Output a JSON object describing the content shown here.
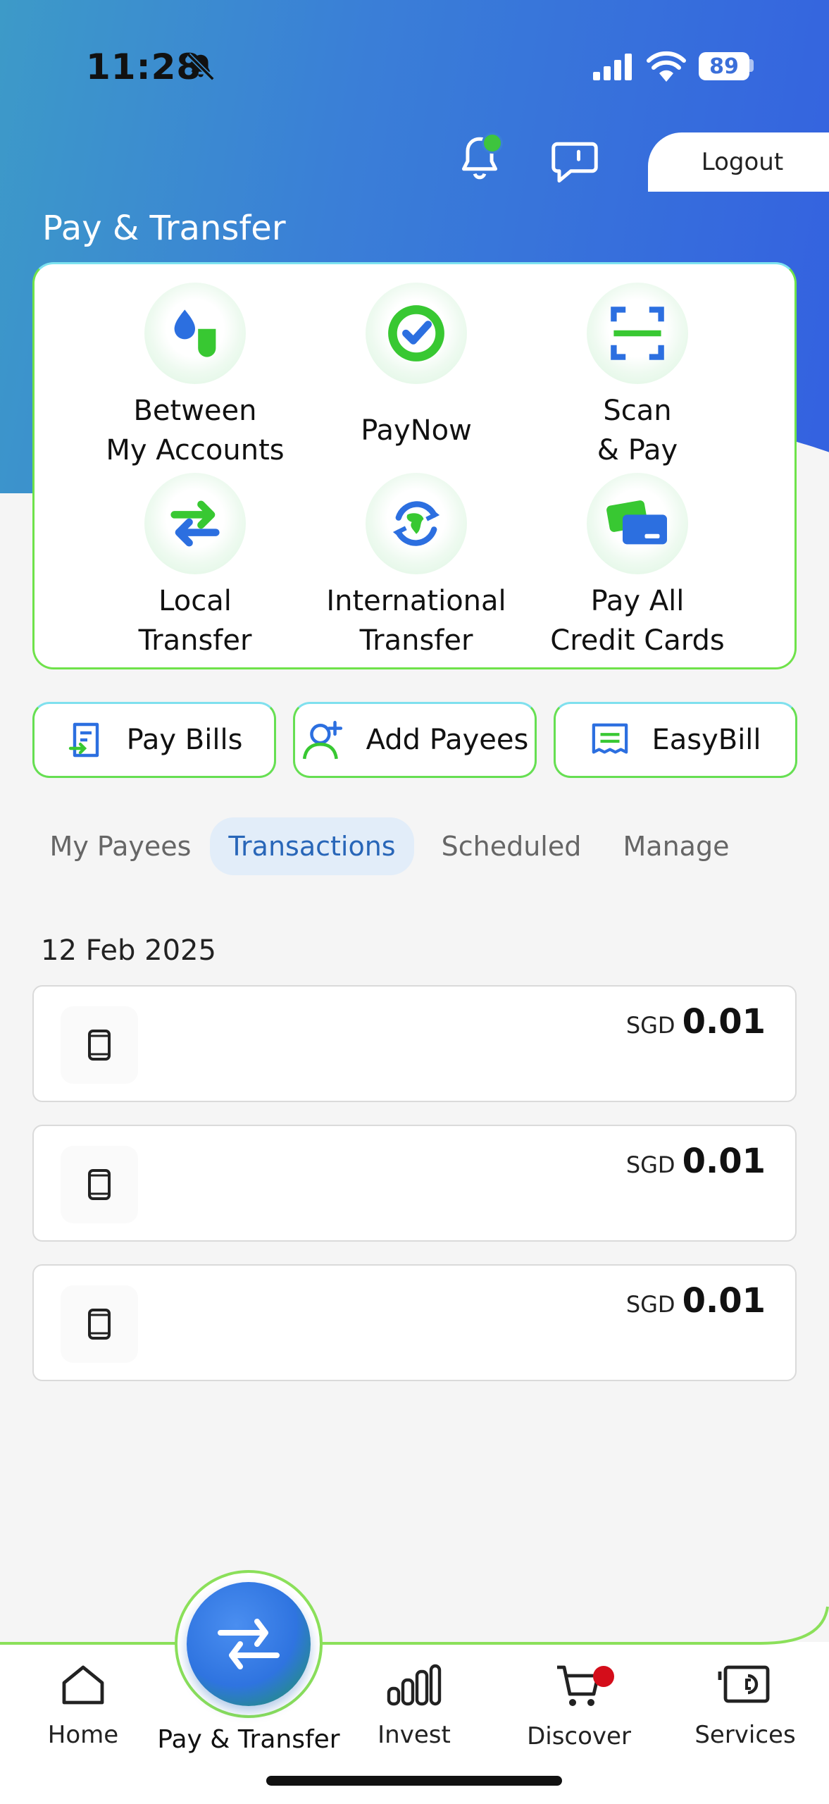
{
  "status_bar": {
    "time": "11:28",
    "battery": "89"
  },
  "header": {
    "logout_label": "Logout",
    "title": "Pay & Transfer"
  },
  "quick_actions": [
    {
      "label": "Between\nMy Accounts",
      "icon": "between-accounts-icon"
    },
    {
      "label": "PayNow",
      "icon": "paynow-icon"
    },
    {
      "label": "Scan\n& Pay",
      "icon": "scan-icon"
    },
    {
      "label": "Local\nTransfer",
      "icon": "local-transfer-icon"
    },
    {
      "label": "International\nTransfer",
      "icon": "international-transfer-icon"
    },
    {
      "label": "Pay All\nCredit Cards",
      "icon": "credit-card-icon"
    }
  ],
  "pills": [
    {
      "label": "Pay Bills",
      "icon": "bill-icon"
    },
    {
      "label": "Add Payees",
      "icon": "add-person-icon"
    },
    {
      "label": "EasyBill",
      "icon": "receipt-icon"
    }
  ],
  "tabs": [
    {
      "label": "My Payees",
      "active": false
    },
    {
      "label": "Transactions",
      "active": true
    },
    {
      "label": "Scheduled",
      "active": false
    },
    {
      "label": "Manage",
      "active": false
    }
  ],
  "transactions": {
    "date": "12 Feb 2025",
    "items": [
      {
        "currency": "SGD",
        "amount": "0.01",
        "icon": "mobile-phone-icon"
      },
      {
        "currency": "SGD",
        "amount": "0.01",
        "icon": "mobile-phone-icon"
      },
      {
        "currency": "SGD",
        "amount": "0.01",
        "icon": "mobile-phone-icon"
      }
    ]
  },
  "nav": {
    "home": "Home",
    "pay_transfer": "Pay & Transfer",
    "invest": "Invest",
    "discover": "Discover",
    "services": "Services"
  },
  "colors": {
    "brand_blue": "#3461e0",
    "accent_green": "#3ec43e",
    "alert_red": "#d40d1a"
  }
}
